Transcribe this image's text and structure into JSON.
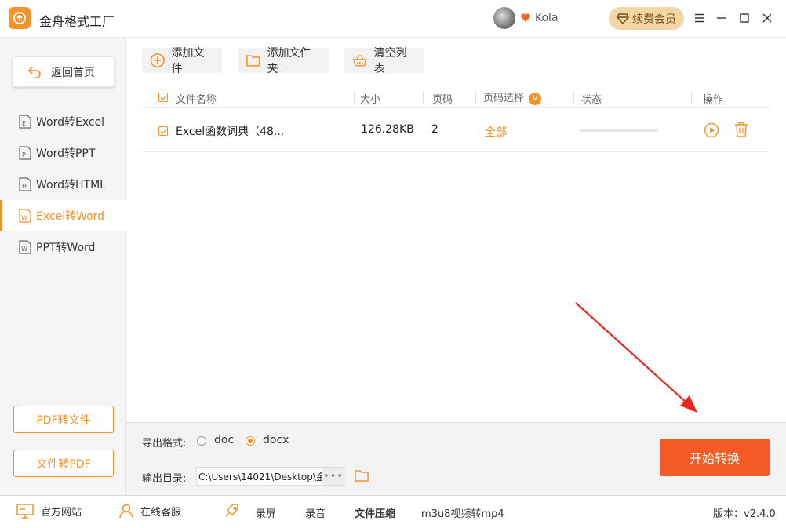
{
  "app": {
    "title": "金舟格式工厂",
    "user_name": "Kola",
    "renew_label": "续费会员"
  },
  "sidebar": {
    "back_label": "返回首页",
    "items": [
      {
        "label": "Word转Excel",
        "icon_letter": "E"
      },
      {
        "label": "Word转PPT",
        "icon_letter": "P"
      },
      {
        "label": "Word转HTML",
        "icon_letter": "H"
      },
      {
        "label": "Excel转Word",
        "icon_letter": "W"
      },
      {
        "label": "PPT转Word",
        "icon_letter": "W"
      }
    ],
    "pdf_to_file": "PDF转文件",
    "file_to_pdf": "文件转PDF"
  },
  "toolbar": {
    "add_file": "添加文件",
    "add_folder": "添加文件夹",
    "clear_list": "清空列表"
  },
  "table": {
    "headers": {
      "name": "文件名称",
      "size": "大小",
      "pages": "页码",
      "page_select": "页码选择",
      "page_select_badge": "V",
      "status": "状态",
      "actions": "操作"
    },
    "rows": [
      {
        "name": "Excel函数词典（48...",
        "size": "126.28KB",
        "pages": "2",
        "page_select": "全部",
        "progress": 0
      }
    ]
  },
  "options": {
    "format_label": "导出格式:",
    "format_options": [
      "doc",
      "docx"
    ],
    "format_selected": "docx",
    "dir_label": "输出目录:",
    "dir_value": "C:\\Users\\14021\\Desktop\\金",
    "dir_more": "•••",
    "start_label": "开始转换"
  },
  "footer": {
    "website": "官方网站",
    "support": "在线客服",
    "record_screen": "录屏",
    "record_audio": "录音",
    "compress": "文件压缩",
    "m3u8": "m3u8视频转mp4",
    "version": "版本：v2.4.0"
  },
  "colors": {
    "accent": "#f5922a",
    "start_button": "#f65a24",
    "annotation": "#e8261c"
  }
}
